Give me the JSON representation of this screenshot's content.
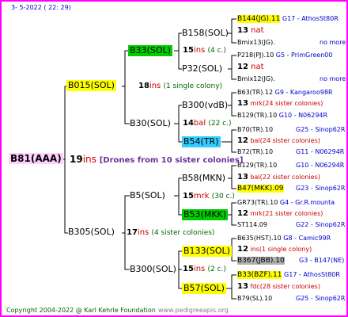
{
  "header": {
    "date": "3-  5-2022 ( 22: 29)"
  },
  "root": {
    "name": "B81(AAA)",
    "ins_value": "19",
    "ins_label": "ins",
    "note": "[Drones from 10 sister colonies]"
  },
  "gen2": [
    {
      "name": "B015(SOL)",
      "ins_value": "18",
      "ins_label": "ins",
      "note": "(1 single colony)"
    },
    {
      "name": "B305(SOL)",
      "ins_value": "17",
      "ins_label": "ins",
      "note": "(4 sister colonies)"
    }
  ],
  "gen3": [
    {
      "name": "B33(SOL)",
      "ins_value": "15",
      "ins_label": "ins",
      "note": "(4 c.)"
    },
    {
      "name": "B30(SOL)",
      "ins_value": "14",
      "ins_label": "bal",
      "note": "(22 c.)"
    },
    {
      "name": "B5(SOL)",
      "ins_value": "15",
      "ins_label": "mrk",
      "note": "(30 c.)"
    },
    {
      "name": "B300(SOL)",
      "ins_value": "15",
      "ins_label": "ins",
      "note": "(2 c.)"
    }
  ],
  "gen4": [
    {
      "name": "B158(SOL)"
    },
    {
      "name": "P32(SOL)"
    },
    {
      "name": "B300(vdB)"
    },
    {
      "name": "B54(TR)"
    },
    {
      "name": "B58(MKN)"
    },
    {
      "name": "B53(MKK)"
    },
    {
      "name": "B133(SOL)"
    },
    {
      "name": "B57(SOL)"
    }
  ],
  "gen5": [
    {
      "name": "B144(JG).11",
      "info": "G17 - AthosSt80R"
    },
    {
      "ins_value": "13",
      "ins_label": "nat"
    },
    {
      "name": "Bmix13(JG).",
      "info": "no more"
    },
    {
      "name": "P218(PJ).10",
      "info": "G5 - PrimGreen00"
    },
    {
      "ins_value": "12",
      "ins_label": "nat"
    },
    {
      "name": "Bmix12(JG).",
      "info": "no more"
    },
    {
      "name": "B63(TR).12",
      "info": "G9 - Kangaroo98R"
    },
    {
      "ins_value": "13",
      "ins_label": "mrk(24 sister colonies)"
    },
    {
      "name": "B129(TR).10",
      "info": "G10 - N06294R"
    },
    {
      "name": "B70(TR).10",
      "info": "G25 - Sinop62R"
    },
    {
      "ins_value": "12",
      "ins_label": "bal(24 sister colonies)"
    },
    {
      "name": "B72(TR).10",
      "info": "G11 - N06294R"
    },
    {
      "name": "B129(TR).10",
      "info": "G10 - N06294R"
    },
    {
      "ins_value": "13",
      "ins_label": "bal(22 sister colonies)"
    },
    {
      "name": "B47(MKK).09",
      "info": "G23 - Sinop62R"
    },
    {
      "name": "GR73(TR).10",
      "info": "G4 - Gr.R.mounta"
    },
    {
      "ins_value": "12",
      "ins_label": "mrk(21 sister colonies)"
    },
    {
      "name": "ST114.09",
      "info": "G22 - Sinop62R"
    },
    {
      "name": "B635(HST).10",
      "info": "G8 - Camic99R"
    },
    {
      "ins_value": "12",
      "ins_label": "ins(1 single colony)"
    },
    {
      "name": "B367(JBB).10",
      "info": "G3 - B147(NE)"
    },
    {
      "name": "B33(BZF).11",
      "info": "G17 - AthosSt80R"
    },
    {
      "ins_value": "13",
      "ins_label": "fdc(28 sister colonies)"
    },
    {
      "name": "B79(SL).10",
      "info": "G25 - Sinop62R"
    }
  ],
  "footer": {
    "copyright": "Copyright 2004-2022 @ Karl Kehrle Foundation",
    "url": "www.pedigreeapis.org"
  }
}
